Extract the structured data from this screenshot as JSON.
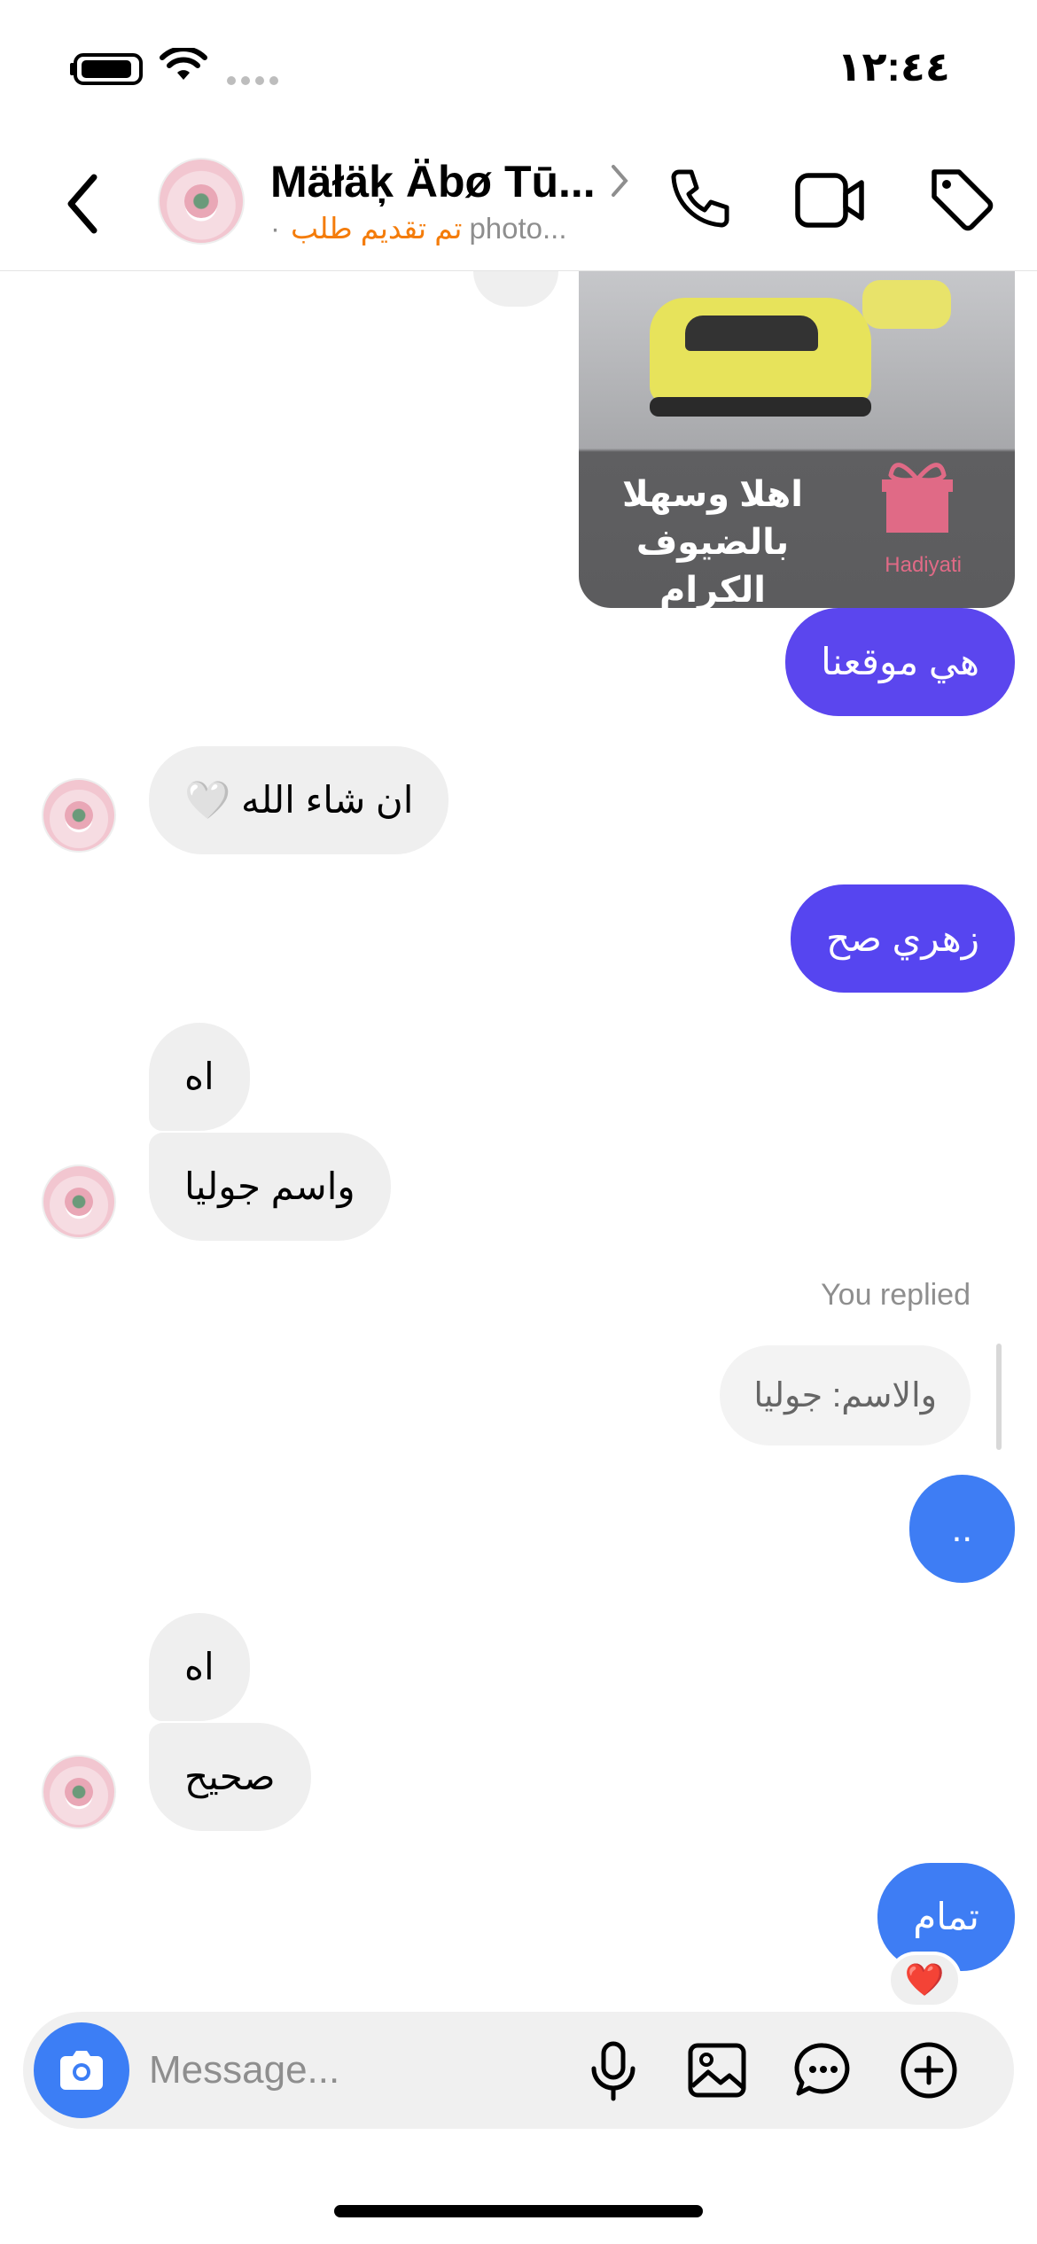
{
  "status_bar": {
    "time": "١٢:٤٤"
  },
  "header": {
    "contact_name": "Mäłäķ Äbø Tū...",
    "status_text": "تم تقديم طلب",
    "sub_text": "photo...",
    "separator": "·"
  },
  "colors": {
    "outgoing_purple": "#5b46ee",
    "outgoing_blue": "#3e7df4",
    "incoming": "#efefef",
    "status_orange": "#f47c0a",
    "camera_button": "#3c7ef5"
  },
  "photo_message": {
    "caption_line1": "اهلا وسهلا",
    "caption_line2": "بالضيوف الكرام",
    "logo_text": "Hadiyati"
  },
  "messages": {
    "m1": "هي موقعنا",
    "m2": "ان شاء الله 🤍",
    "m3": "زهري صح",
    "m4": "اه",
    "m5": "واسم جوليا",
    "replied_label": "You replied",
    "reply_quote": "والاسم: جوليا",
    "m6": "..",
    "m7": "اه",
    "m8": "صحيح",
    "m9": "تمام",
    "reaction": "❤️"
  },
  "composer": {
    "placeholder": "Message..."
  }
}
